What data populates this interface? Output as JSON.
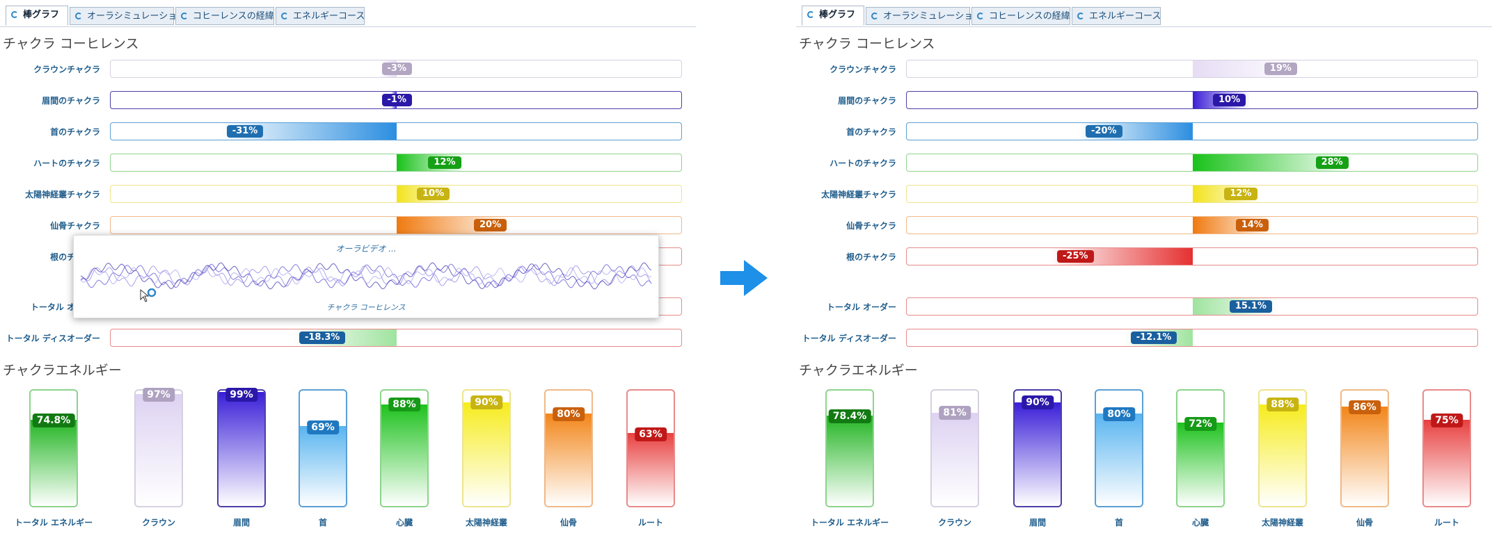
{
  "tabs": [
    {
      "label": "棒グラフ",
      "icon": "spinner-icon",
      "active": true
    },
    {
      "label": "オーラシミュレーション",
      "icon": "spinner-icon",
      "active": false
    },
    {
      "label": "コヒーレンスの経緯",
      "icon": "spinner-icon",
      "active": false
    },
    {
      "label": "エネルギーコース",
      "icon": "spinner-icon",
      "active": false
    }
  ],
  "before": {
    "coherence_title": "チャクラ コーヒレンス",
    "energy_title": "チャクラエネルギー",
    "coherence_rows": [
      {
        "label": "クラウンチャクラ",
        "value": -3,
        "value_text": "-3%",
        "fill_color": "#e6dcf4",
        "pill_color": "#b2a6c2",
        "border_color": "#d6d0e0"
      },
      {
        "label": "眉間のチャクラ",
        "value": -1,
        "value_text": "-1%",
        "fill_color": "#3b1fd6",
        "pill_color": "#2a18a8",
        "border_color": "#4a3fa8"
      },
      {
        "label": "首のチャクラ",
        "value": -31,
        "value_text": "-31%",
        "fill_color": "#2b8ee0",
        "pill_color": "#1f6fb0",
        "border_color": "#5a9fd6"
      },
      {
        "label": "ハートのチャクラ",
        "value": 12,
        "value_text": "12%",
        "fill_color": "#19c21a",
        "pill_color": "#16a016",
        "border_color": "#8cd48c"
      },
      {
        "label": "太陽神経叢チャクラ",
        "value": 10,
        "value_text": "10%",
        "fill_color": "#f2e31a",
        "pill_color": "#c7b412",
        "border_color": "#eee48c"
      },
      {
        "label": "仙骨チャクラ",
        "value": 20,
        "value_text": "20%",
        "fill_color": "#f07a10",
        "pill_color": "#c9600c",
        "border_color": "#f0b888"
      },
      {
        "label": "根のチャクラ",
        "value": 0,
        "value_text": "",
        "fill_color": "#e53030",
        "pill_color": "#c01818",
        "border_color": "#e88a8a"
      },
      {
        "label": "トータル オーダー",
        "value": 0,
        "value_text": "",
        "fill_color": "#9fe39f",
        "pill_color": "#1a5f9e",
        "border_color": "#e88a8a"
      },
      {
        "label": "トータル ディスオーダー",
        "value": -18.3,
        "value_text": "-18.3%",
        "fill_color": "#9fe39f",
        "pill_color": "#1a5f9e",
        "border_color": "#e88a8a"
      }
    ],
    "energy_tubes": [
      {
        "label": "トータル エネルギー",
        "value": 74.8,
        "value_text": "74.8%",
        "color": "#22b522",
        "pill_color": "#127a12",
        "border_color": "#8cd48c"
      },
      {
        "label": "クラウン",
        "value": 97,
        "value_text": "97%",
        "color": "#ddd2f2",
        "pill_color": "#aea2c0",
        "border_color": "#d6d0e0"
      },
      {
        "label": "眉間",
        "value": 99,
        "value_text": "99%",
        "color": "#3a1ed8",
        "pill_color": "#2a18a8",
        "border_color": "#4a3fa8"
      },
      {
        "label": "首",
        "value": 69,
        "value_text": "69%",
        "color": "#58b4f0",
        "pill_color": "#1f78c0",
        "border_color": "#5a9fd6"
      },
      {
        "label": "心臓",
        "value": 88,
        "value_text": "88%",
        "color": "#1ec21e",
        "pill_color": "#179a17",
        "border_color": "#8cd48c"
      },
      {
        "label": "太陽神経叢",
        "value": 90,
        "value_text": "90%",
        "color": "#f6ec1e",
        "pill_color": "#c7b412",
        "border_color": "#eee48c"
      },
      {
        "label": "仙骨",
        "value": 80,
        "value_text": "80%",
        "color": "#f2861a",
        "pill_color": "#c9600c",
        "border_color": "#f0b888"
      },
      {
        "label": "ルート",
        "value": 63,
        "value_text": "63%",
        "color": "#e84040",
        "pill_color": "#c01818",
        "border_color": "#e88a8a"
      }
    ],
    "popup": {
      "title": "オーラビデオ ...",
      "caption": "チャクラ コーヒレンス"
    }
  },
  "after": {
    "coherence_title": "チャクラ コーヒレンス",
    "energy_title": "チャクラエネルギー",
    "coherence_rows": [
      {
        "label": "クラウンチャクラ",
        "value": 19,
        "value_text": "19%",
        "fill_color": "#e6dcf4",
        "pill_color": "#b2a6c2",
        "border_color": "#d6d0e0"
      },
      {
        "label": "眉間のチャクラ",
        "value": 10,
        "value_text": "10%",
        "fill_color": "#3b1fd6",
        "pill_color": "#2a18a8",
        "border_color": "#4a3fa8"
      },
      {
        "label": "首のチャクラ",
        "value": -20,
        "value_text": "-20%",
        "fill_color": "#2b8ee0",
        "pill_color": "#1f6fb0",
        "border_color": "#5a9fd6"
      },
      {
        "label": "ハートのチャクラ",
        "value": 28,
        "value_text": "28%",
        "fill_color": "#19c21a",
        "pill_color": "#16a016",
        "border_color": "#8cd48c"
      },
      {
        "label": "太陽神経叢チャクラ",
        "value": 12,
        "value_text": "12%",
        "fill_color": "#f2e31a",
        "pill_color": "#c7b412",
        "border_color": "#eee48c"
      },
      {
        "label": "仙骨チャクラ",
        "value": 14,
        "value_text": "14%",
        "fill_color": "#f07a10",
        "pill_color": "#c9600c",
        "border_color": "#f0b888"
      },
      {
        "label": "根のチャクラ",
        "value": -25,
        "value_text": "-25%",
        "fill_color": "#e53030",
        "pill_color": "#c01818",
        "border_color": "#e88a8a"
      },
      {
        "label": "トータル オーダー",
        "value": 15.1,
        "value_text": "15.1%",
        "fill_color": "#9fe39f",
        "pill_color": "#1a5f9e",
        "border_color": "#e88a8a"
      },
      {
        "label": "トータル ディスオーダー",
        "value": -12.1,
        "value_text": "-12.1%",
        "fill_color": "#9fe39f",
        "pill_color": "#1a5f9e",
        "border_color": "#e88a8a"
      }
    ],
    "energy_tubes": [
      {
        "label": "トータル エネルギー",
        "value": 78.4,
        "value_text": "78.4%",
        "color": "#22b522",
        "pill_color": "#127a12",
        "border_color": "#8cd48c"
      },
      {
        "label": "クラウン",
        "value": 81,
        "value_text": "81%",
        "color": "#ddd2f2",
        "pill_color": "#aea2c0",
        "border_color": "#d6d0e0"
      },
      {
        "label": "眉間",
        "value": 90,
        "value_text": "90%",
        "color": "#3a1ed8",
        "pill_color": "#2a18a8",
        "border_color": "#4a3fa8"
      },
      {
        "label": "首",
        "value": 80,
        "value_text": "80%",
        "color": "#58b4f0",
        "pill_color": "#1f78c0",
        "border_color": "#5a9fd6"
      },
      {
        "label": "心臓",
        "value": 72,
        "value_text": "72%",
        "color": "#1ec21e",
        "pill_color": "#179a17",
        "border_color": "#8cd48c"
      },
      {
        "label": "太陽神経叢",
        "value": 88,
        "value_text": "88%",
        "color": "#f6ec1e",
        "pill_color": "#c7b412",
        "border_color": "#eee48c"
      },
      {
        "label": "仙骨",
        "value": 86,
        "value_text": "86%",
        "color": "#f2861a",
        "pill_color": "#c9600c",
        "border_color": "#f0b888"
      },
      {
        "label": "ルート",
        "value": 75,
        "value_text": "75%",
        "color": "#e84040",
        "pill_color": "#c01818",
        "border_color": "#e88a8a"
      }
    ]
  },
  "arrow": {
    "icon": "right-arrow-icon",
    "color": "#1e90e8"
  }
}
